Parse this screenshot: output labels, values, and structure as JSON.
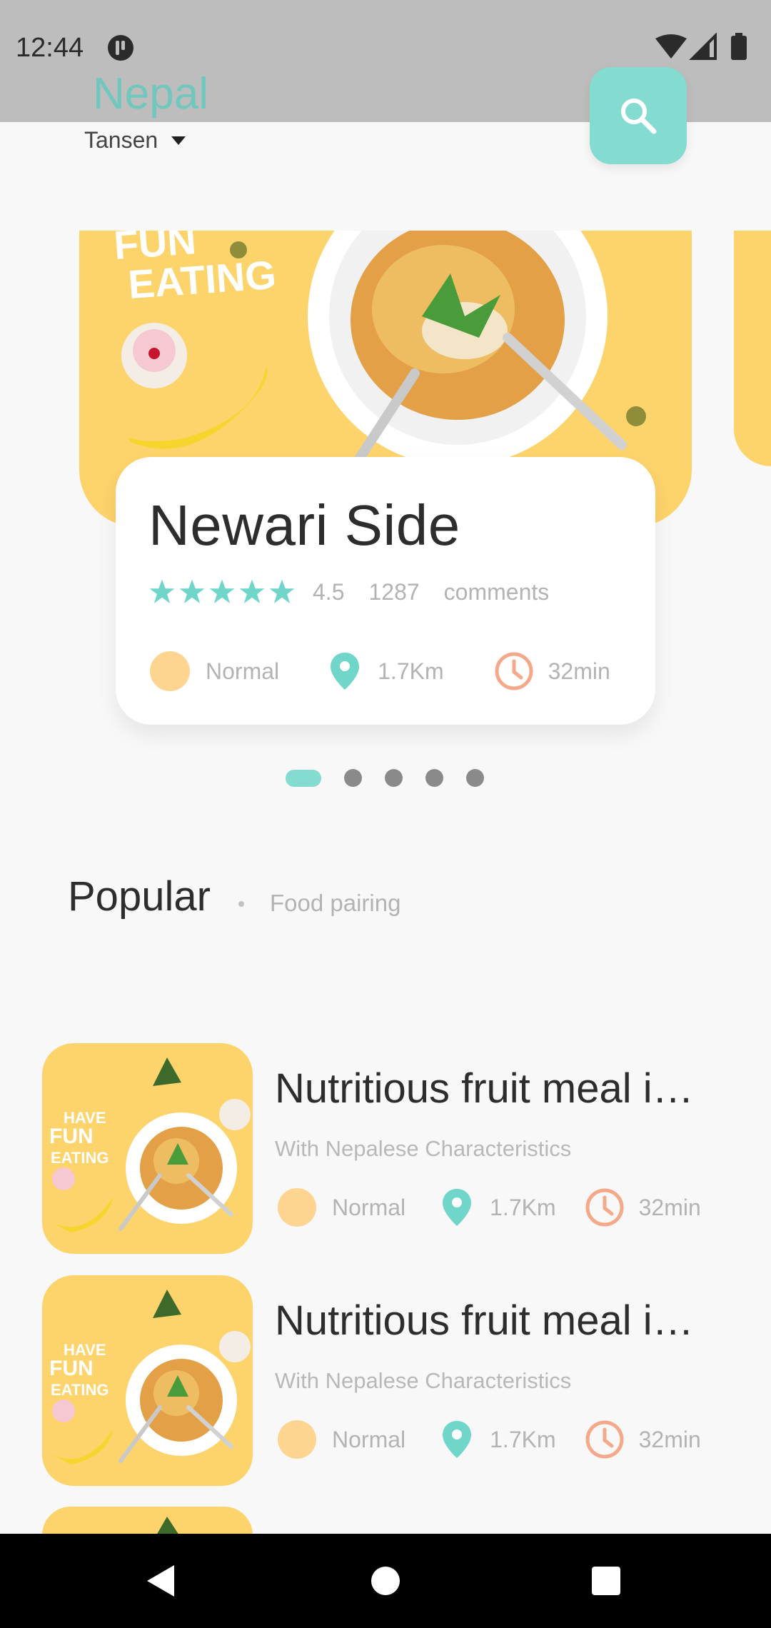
{
  "status_bar": {
    "time": "12:44"
  },
  "header": {
    "brand": "Nepal",
    "location": "Tansen"
  },
  "hero": {
    "image_text_line1": "FUN",
    "image_text_line2": "EATING",
    "title": "Newari Side",
    "rating": "4.5",
    "rating_fraction": 0.9,
    "comment_count": "1287",
    "comment_label": "comments",
    "level": "Normal",
    "distance": "1.7Km",
    "time": "32min"
  },
  "pager": {
    "count": 5,
    "active_index": 0
  },
  "section": {
    "title": "Popular",
    "subtitle": "Food pairing"
  },
  "items": [
    {
      "thumb_text": [
        "HAVE",
        "FUN",
        "EATING"
      ],
      "title": "Nutritious fruit meal i…",
      "subtitle": "With Nepalese Characteristics",
      "level": "Normal",
      "distance": "1.7Km",
      "time": "32min"
    },
    {
      "thumb_text": [
        "HAVE",
        "FUN",
        "EATING"
      ],
      "title": "Nutritious fruit meal i…",
      "subtitle": "With Nepalese Characteristics",
      "level": "Normal",
      "distance": "1.7Km",
      "time": "32min"
    }
  ],
  "colors": {
    "accent": "#84dbd0",
    "brand_text": "#6fc7bd",
    "food_bg": "#fdd36c",
    "level_dot": "#fdd590",
    "clock": "#f5a88a",
    "pin": "#6fd6c9"
  },
  "icons": {
    "search": "search-icon",
    "dropdown": "caret-down-icon",
    "star": "star-icon",
    "pin": "location-pin-icon",
    "clock": "clock-icon"
  }
}
